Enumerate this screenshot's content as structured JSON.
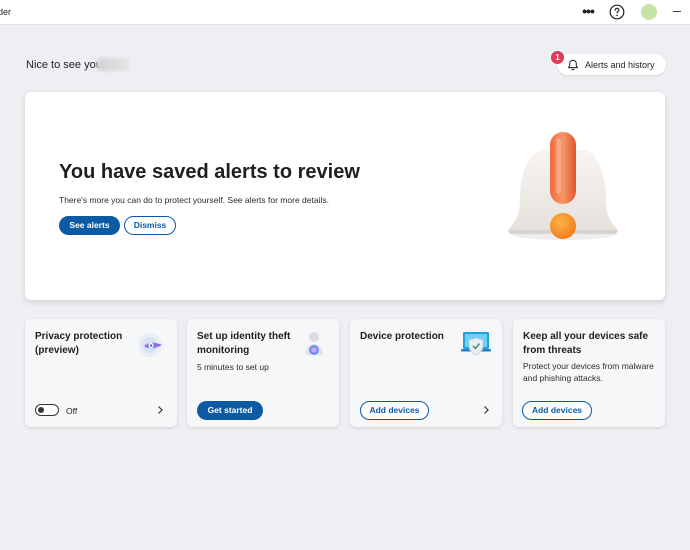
{
  "window": {
    "title": "der"
  },
  "header": {
    "greeting": "Nice to see you,"
  },
  "alerts_button": {
    "label": "Alerts and history",
    "badge_count": "1"
  },
  "hero": {
    "title": "You have saved alerts to review",
    "description": "There's more you can do to protect yourself. See alerts for more details.",
    "primary_label": "See alerts",
    "secondary_label": "Dismiss"
  },
  "cards": [
    {
      "title_line1": "Privacy protection",
      "title_line2": "(preview)",
      "toggle_label": "Off",
      "toggle_on": false
    },
    {
      "title_line1": "Set up identity theft",
      "title_line2": "monitoring",
      "description": "5 minutes to set up",
      "button_label": "Get started"
    },
    {
      "title_line1": "Device protection",
      "button_label": "Add devices"
    },
    {
      "title_line1": "Keep all your devices safe",
      "title_line2": "from threats",
      "desc_line1": "Protect your devices from malware",
      "desc_line2": "and phishing attacks.",
      "button_label": "Add devices"
    }
  ],
  "colors": {
    "accent": "#0b5aa3",
    "badge": "#e03a5a",
    "background": "#eeeff2",
    "card": "#f6f7f9"
  },
  "icons": [
    "more-icon",
    "help-icon",
    "bell-icon",
    "alert-bell-illustration",
    "privacy-shield-icon",
    "identity-icon",
    "device-laptop-icon",
    "chevron-right-icon"
  ]
}
